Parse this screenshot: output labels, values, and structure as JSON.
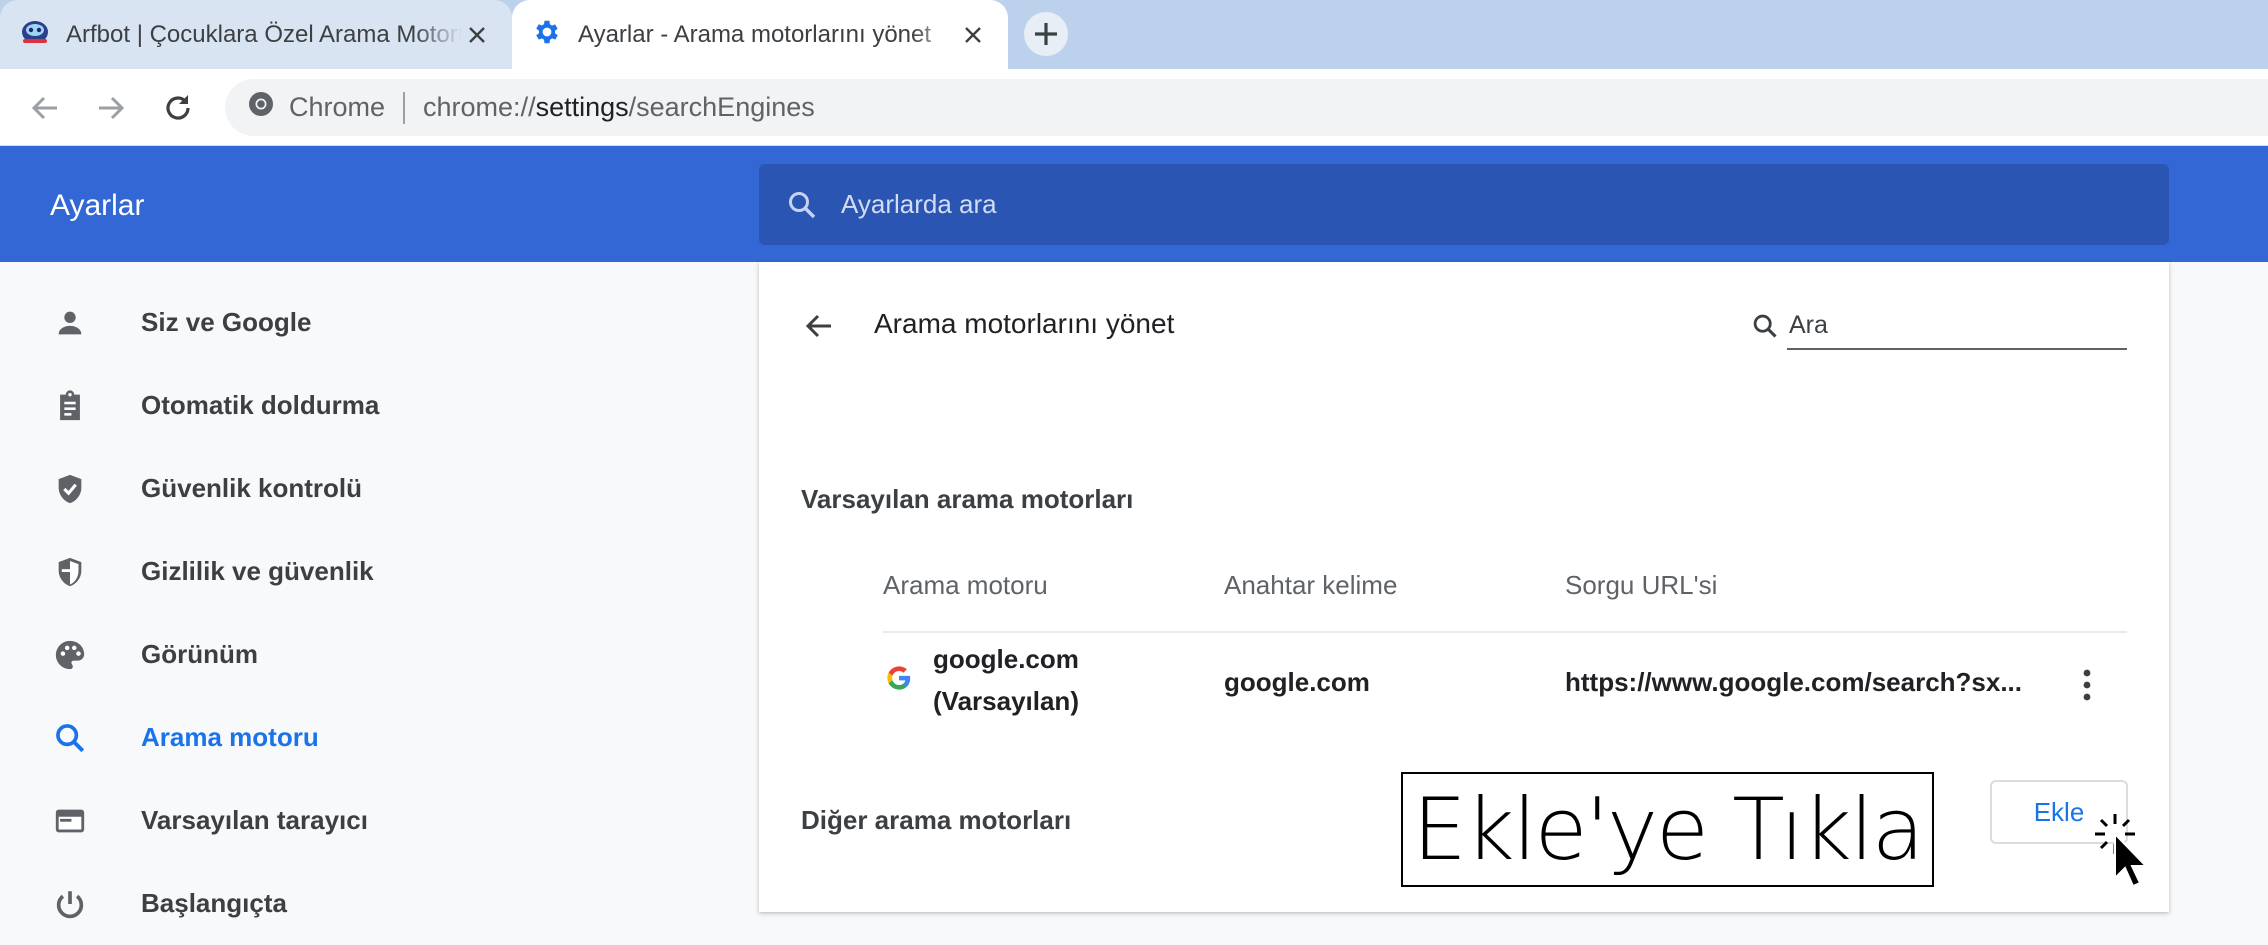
{
  "browser": {
    "tabs": [
      {
        "title": "Arfbot | Çocuklara Özel Arama Motoru",
        "icon": "robot-favicon",
        "active": false
      },
      {
        "title": "Ayarlar - Arama motorlarını yönet",
        "icon": "gear-favicon",
        "active": true
      }
    ],
    "omnibox": {
      "chip": "Chrome",
      "url_scheme": "chrome://",
      "url_host": "settings",
      "url_path": "/searchEngines"
    }
  },
  "header": {
    "title": "Ayarlar",
    "search_placeholder": "Ayarlarda ara"
  },
  "sidebar": {
    "items": [
      {
        "label": "Siz ve Google",
        "icon": "person-icon"
      },
      {
        "label": "Otomatik doldurma",
        "icon": "clipboard-icon"
      },
      {
        "label": "Güvenlik kontrolü",
        "icon": "shield-check-icon"
      },
      {
        "label": "Gizlilik ve güvenlik",
        "icon": "shield-icon"
      },
      {
        "label": "Görünüm",
        "icon": "palette-icon"
      },
      {
        "label": "Arama motoru",
        "icon": "search-icon",
        "active": true
      },
      {
        "label": "Varsayılan tarayıcı",
        "icon": "browser-window-icon"
      },
      {
        "label": "Başlangıçta",
        "icon": "power-icon"
      }
    ]
  },
  "main": {
    "title": "Arama motorlarını yönet",
    "search_placeholder": "Ara",
    "default_section": "Varsayılan arama motorları",
    "other_section": "Diğer arama motorları",
    "columns": [
      "Arama motoru",
      "Anahtar kelime",
      "Sorgu URL'si"
    ],
    "engines": [
      {
        "name": "google.com",
        "note": "(Varsayılan)",
        "keyword": "google.com",
        "url": "https://www.google.com/search?sx...",
        "icon": "google-g-icon"
      }
    ],
    "add_label": "Ekle"
  },
  "annotation": {
    "text": "Ekle'ye Tıkla"
  },
  "colors": {
    "accent": "#1a73e8",
    "header_bg": "#3367d6",
    "search_bg": "#2a55b3"
  }
}
